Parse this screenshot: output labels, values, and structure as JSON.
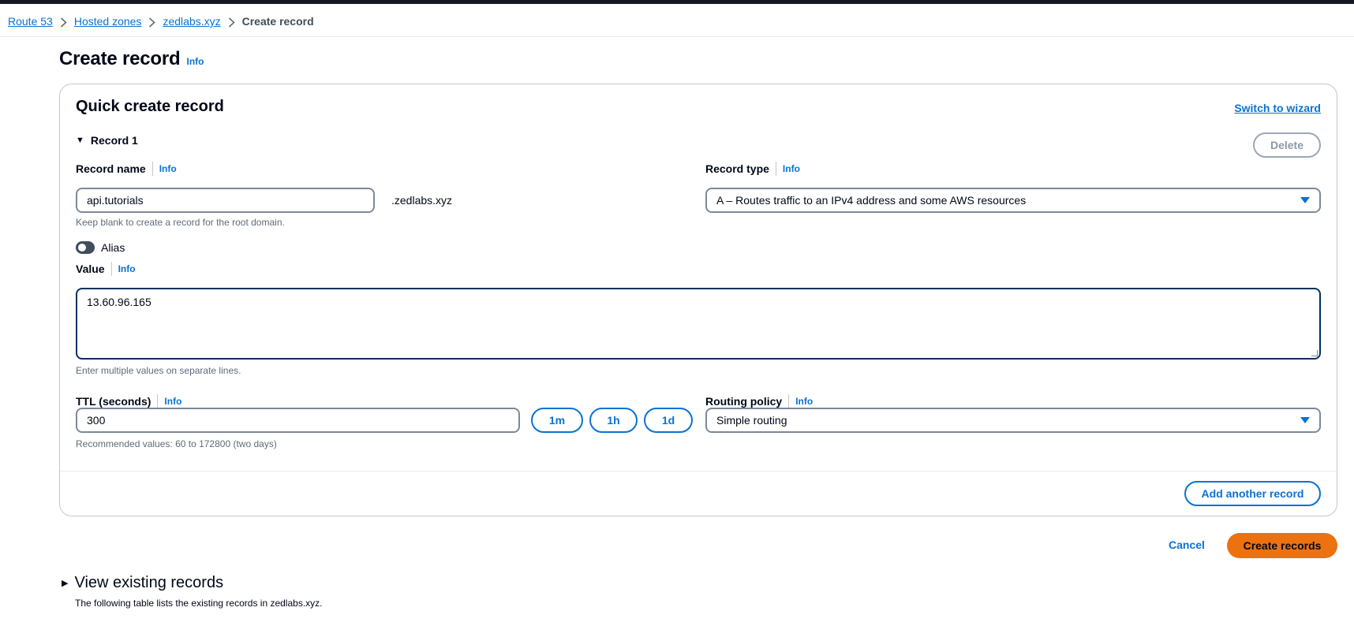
{
  "breadcrumb": {
    "items": [
      "Route 53",
      "Hosted zones",
      "zedlabs.xyz"
    ],
    "current": "Create record"
  },
  "page": {
    "title": "Create record",
    "info": "Info"
  },
  "panel": {
    "title": "Quick create record",
    "switch_wizard": "Switch to wizard",
    "record_toggle": "Record 1",
    "delete_label": "Delete"
  },
  "record_name": {
    "label": "Record name",
    "info": "Info",
    "value": "api.tutorials",
    "suffix": ".zedlabs.xyz",
    "hint": "Keep blank to create a record for the root domain."
  },
  "record_type": {
    "label": "Record type",
    "info": "Info",
    "value": "A – Routes traffic to an IPv4 address and some AWS resources"
  },
  "alias": {
    "label": "Alias",
    "enabled": false
  },
  "value_field": {
    "label": "Value",
    "info": "Info",
    "value": "13.60.96.165",
    "hint": "Enter multiple values on separate lines."
  },
  "ttl": {
    "label": "TTL (seconds)",
    "info": "Info",
    "value": "300",
    "hint": "Recommended values: 60 to 172800 (two days)",
    "presets": [
      "1m",
      "1h",
      "1d"
    ]
  },
  "routing_policy": {
    "label": "Routing policy",
    "info": "Info",
    "value": "Simple routing"
  },
  "actions": {
    "add_another": "Add another record",
    "cancel": "Cancel",
    "create": "Create records"
  },
  "existing": {
    "title": "View existing records",
    "description": "The following table lists the existing records in zedlabs.xyz."
  },
  "colors": {
    "link": "#0972d3",
    "primary_button": "#ec7211",
    "topbar": "#16191f"
  }
}
